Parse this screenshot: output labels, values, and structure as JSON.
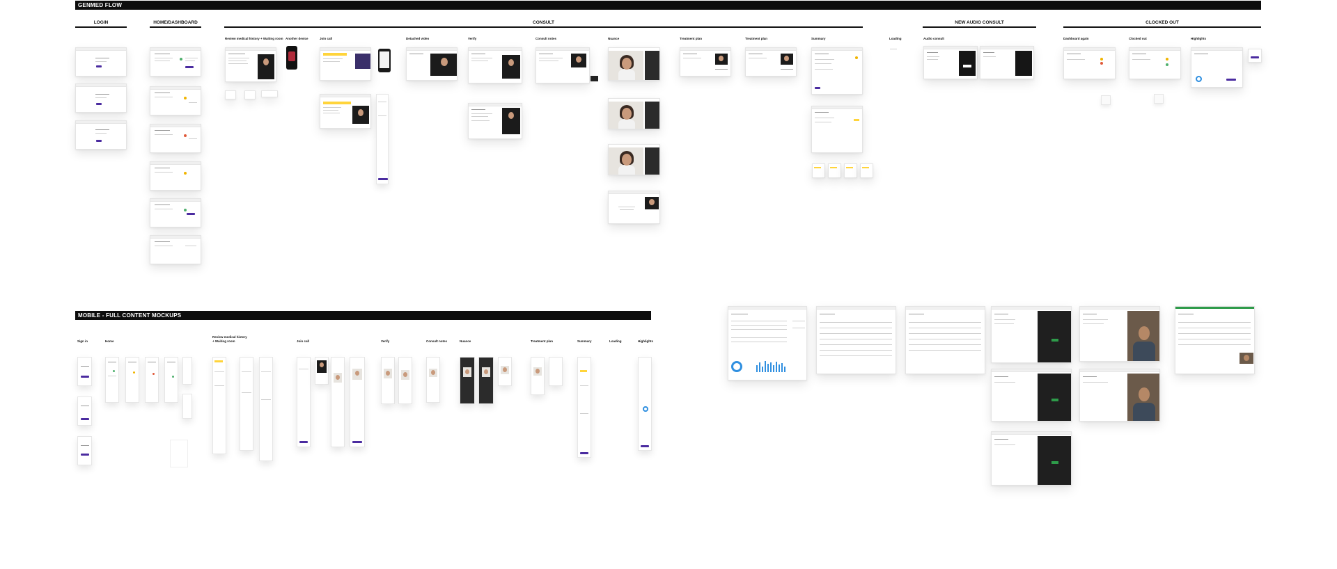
{
  "board": {
    "banner_top": "GENMED FLOW",
    "banner_mobile": "MOBILE - FULL CONTENT MOCKUPS"
  },
  "sections": {
    "login": "LOGIN",
    "home": "HOME/DASHBOARD",
    "consult": "CONSULT",
    "audio": "NEW AUDIO CONSULT",
    "clocked": "CLOCKED OUT"
  },
  "consult_captions": {
    "review": "Review medical history + Waiting room",
    "another_device": "Another device",
    "join_call": "Join call",
    "detached_video": "Detached video",
    "verify": "Verify",
    "consult_notes": "Consult notes",
    "nuance": "Nuance",
    "treatment_plan_1": "Treatment plan",
    "treatment_plan_2": "Treatment plan",
    "summary": "Summary",
    "loading": "Loading",
    "audio_consult": "Audio consult",
    "dashboard_again": "Dashboard again",
    "clocked_out": "Clocked out",
    "highlights": "Highlights"
  },
  "mobile_captions": {
    "sign_in": "Sign in",
    "home": "Home",
    "review_line1": "Review medical history",
    "review_line2": "+ Waiting room",
    "join_call": "Join call",
    "verify": "Verify",
    "consult_notes": "Consult notes",
    "nuance": "Nuance",
    "treatment_plan": "Treatment plan",
    "summary": "Summary",
    "loading": "Loading",
    "highlights": "Highlights"
  },
  "colors": {
    "banner": "#0d0d0d",
    "accent_purple": "#4b2ca0",
    "highlight_yellow": "#ffd43b",
    "video_dark": "#1b1b1b",
    "success_green": "#2e9b4a",
    "chart_blue": "#2f8fe0"
  }
}
